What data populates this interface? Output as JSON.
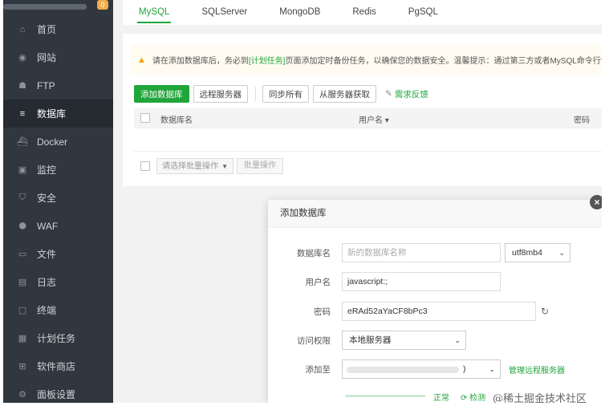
{
  "sidebar": {
    "badge": "0",
    "items": [
      {
        "label": "首页",
        "icon": "home-icon",
        "glyph": "⌂"
      },
      {
        "label": "网站",
        "icon": "globe-icon",
        "glyph": "◉"
      },
      {
        "label": "FTP",
        "icon": "ftp-user-icon",
        "glyph": "☗"
      },
      {
        "label": "数据库",
        "icon": "database-icon",
        "glyph": "≡"
      },
      {
        "label": "Docker",
        "icon": "docker-icon",
        "glyph": "⛴"
      },
      {
        "label": "监控",
        "icon": "monitor-icon",
        "glyph": "▣"
      },
      {
        "label": "安全",
        "icon": "shield-icon",
        "glyph": "⛉"
      },
      {
        "label": "WAF",
        "icon": "waf-icon",
        "glyph": "⬢"
      },
      {
        "label": "文件",
        "icon": "folder-icon",
        "glyph": "▭"
      },
      {
        "label": "日志",
        "icon": "log-icon",
        "glyph": "▤"
      },
      {
        "label": "终端",
        "icon": "terminal-icon",
        "glyph": "▢"
      },
      {
        "label": "计划任务",
        "icon": "calendar-icon",
        "glyph": "▦"
      },
      {
        "label": "软件商店",
        "icon": "apps-icon",
        "glyph": "⊞"
      },
      {
        "label": "面板设置",
        "icon": "settings-icon",
        "glyph": "⚙"
      }
    ]
  },
  "tabs": [
    "MySQL",
    "SQLServer",
    "MongoDB",
    "Redis",
    "PgSQL"
  ],
  "notice": {
    "prefix": "请在添加数据库后，务必到",
    "link": "[计划任务]",
    "suffix": "页面添加定时备份任务，以确保您的数据安全。温馨提示：通过第三方或者MySQL命令行创建的数"
  },
  "toolbar": {
    "add": "添加数据库",
    "remote": "远程服务器",
    "sync_all": "同步所有",
    "fetch": "从服务器获取",
    "feedback": "需求反馈"
  },
  "table": {
    "col_name": "数据库名",
    "col_user": "用户名 ▾",
    "col_pass": "密码"
  },
  "batch": {
    "select_placeholder": "请选择批量操作",
    "button": "批量操作"
  },
  "dialog": {
    "title": "添加数据库",
    "close": "×",
    "db_name_label": "数据库名",
    "db_name_placeholder": "新的数据库名称",
    "charset": "utf8mb4",
    "user_label": "用户名",
    "user_value": "javascript:;",
    "pass_label": "密码",
    "pass_value": "eRAd52aYaCF8bPc3",
    "access_label": "访问权限",
    "access_value": "本地服务器",
    "add_to_label": "添加至",
    "add_to_value": ")",
    "manage_link": "管理远程服务器",
    "status_ok": "正常",
    "check": "检测"
  },
  "watermark": "@稀土掘金技术社区",
  "colors": {
    "accent": "#20a53a",
    "sidebar": "#30373f"
  }
}
